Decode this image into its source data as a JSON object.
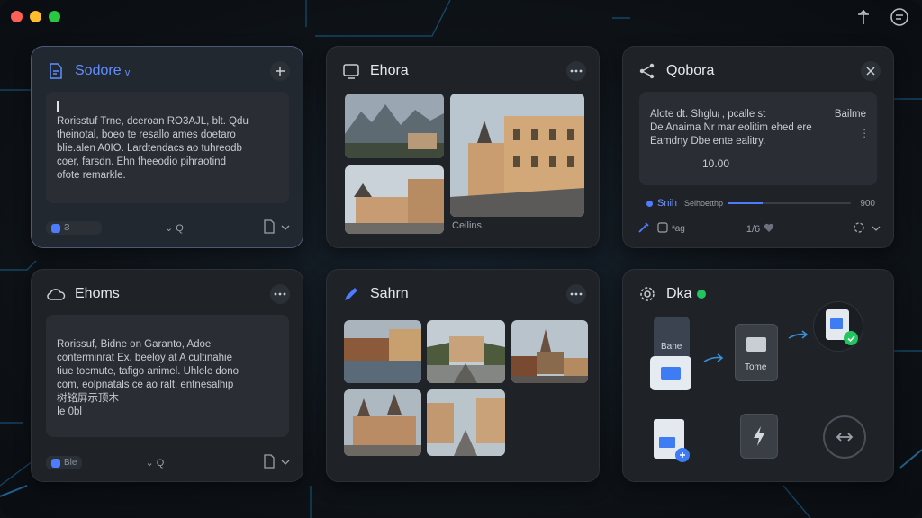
{
  "cards": {
    "c1": {
      "title": "Sodore ᵥ",
      "body": "Rorisstuf Trne, dceroan RO3AJL, blt. Qdu\ntheinotal, boeo te resallo ames doetaro\nblie.alen A0ΙO. Lardtendacs ao tuhreodb\ncoer, farsdn. Ehn fheeodio pihraotind\nofote remarkle.",
      "chip_label": "Ƨ",
      "foot_mid": "⌄ Q"
    },
    "c2": {
      "title": "Ehora",
      "caption": "Ceilins"
    },
    "c3": {
      "title": "Qobora",
      "body_l1": "Alote dt.   Shgluᵢ , pcalle st",
      "body_l1r": "Bailme",
      "body_l2": "De Anaima  Nr mar eolitim ehed ere",
      "body_l3": "Eamdny  Dbe ente ealitry.",
      "value": "10.00",
      "progress_label": "Snih",
      "progress_sub": "Seihoetthp",
      "progress_value": "900",
      "progress": 0.28,
      "foot_left": "ᵃag",
      "foot_mid": "1/6"
    },
    "c4": {
      "title": "Ehoms",
      "body": "Rorissuf, Bidne on Garanto, Adoe\nconterminrat Ex. beeloy at A cultinahie\ntiue tocmute, tafigo animel. Uhlele dono\ncom, eolpnatals ce ao ralt, entnesalhip\n树铭屏示顶木\nǀe 0bl",
      "chip_label": "Ble",
      "foot_mid": "⌄ Q"
    },
    "c5": {
      "title": "Sahrn"
    },
    "c6": {
      "title": "Dka",
      "status_color": "#22c55e",
      "doc1_label": "Bane",
      "doc2_label": "Tome"
    }
  }
}
